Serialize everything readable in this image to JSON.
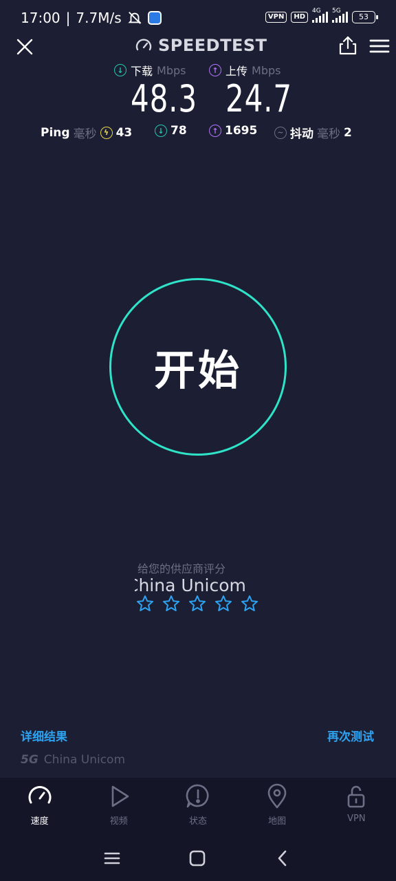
{
  "status": {
    "time": "17:00",
    "speed": "7.7M/s",
    "vpn": "VPN",
    "hd": "HD",
    "net1": "4G",
    "net2": "5G",
    "battery": "53"
  },
  "header": {
    "brand": "SPEEDTEST"
  },
  "results": {
    "download_label": "下载",
    "upload_label": "上传",
    "unit": "Mbps",
    "download_value": "48.3",
    "upload_value": "24.7",
    "ping_label": "Ping",
    "ping_unit": "毫秒",
    "ping_idle": "43",
    "ping_download": "78",
    "ping_upload": "1695",
    "jitter_label": "抖动",
    "jitter_unit": "毫秒",
    "jitter_value": "2"
  },
  "start_button": "开始",
  "rating": {
    "prompt": "给您的供应商评分",
    "provider": "China Unicom",
    "stars": 0
  },
  "links": {
    "details": "详细结果",
    "retest": "再次测试"
  },
  "network": {
    "tag": "5G",
    "name": "China Unicom"
  },
  "tabs": [
    {
      "label": "速度"
    },
    {
      "label": "视频"
    },
    {
      "label": "状态"
    },
    {
      "label": "地图"
    },
    {
      "label": "VPN"
    }
  ],
  "colors": {
    "background": "#1c1f33",
    "accent_teal": "#2ee3c8",
    "link_blue": "#2ea3f2",
    "upload_purple": "#b272f5",
    "ping_yellow": "#e8d54a"
  }
}
